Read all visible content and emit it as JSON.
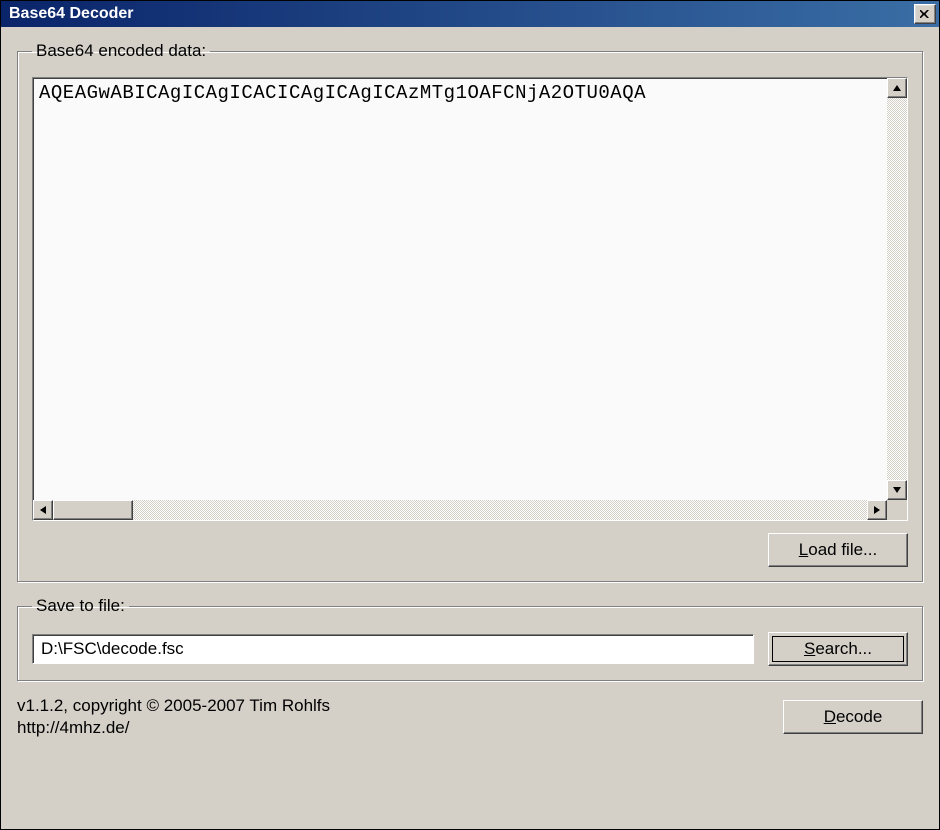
{
  "window": {
    "title": "Base64 Decoder"
  },
  "encoded": {
    "legend": "Base64 encoded data:",
    "text": "AQEAGwABICAgICAgICACICAgICAgICAzMTg1OAFCNjA2OTU0AQA"
  },
  "buttons": {
    "load_file": "Load file...",
    "search": "Search...",
    "decode": "Decode"
  },
  "save": {
    "legend": "Save to file:",
    "path": "D:\\FSC\\decode.fsc"
  },
  "about": {
    "line1": "v1.1.2, copyright © 2005-2007 Tim Rohlfs",
    "line2": "http://4mhz.de/"
  }
}
